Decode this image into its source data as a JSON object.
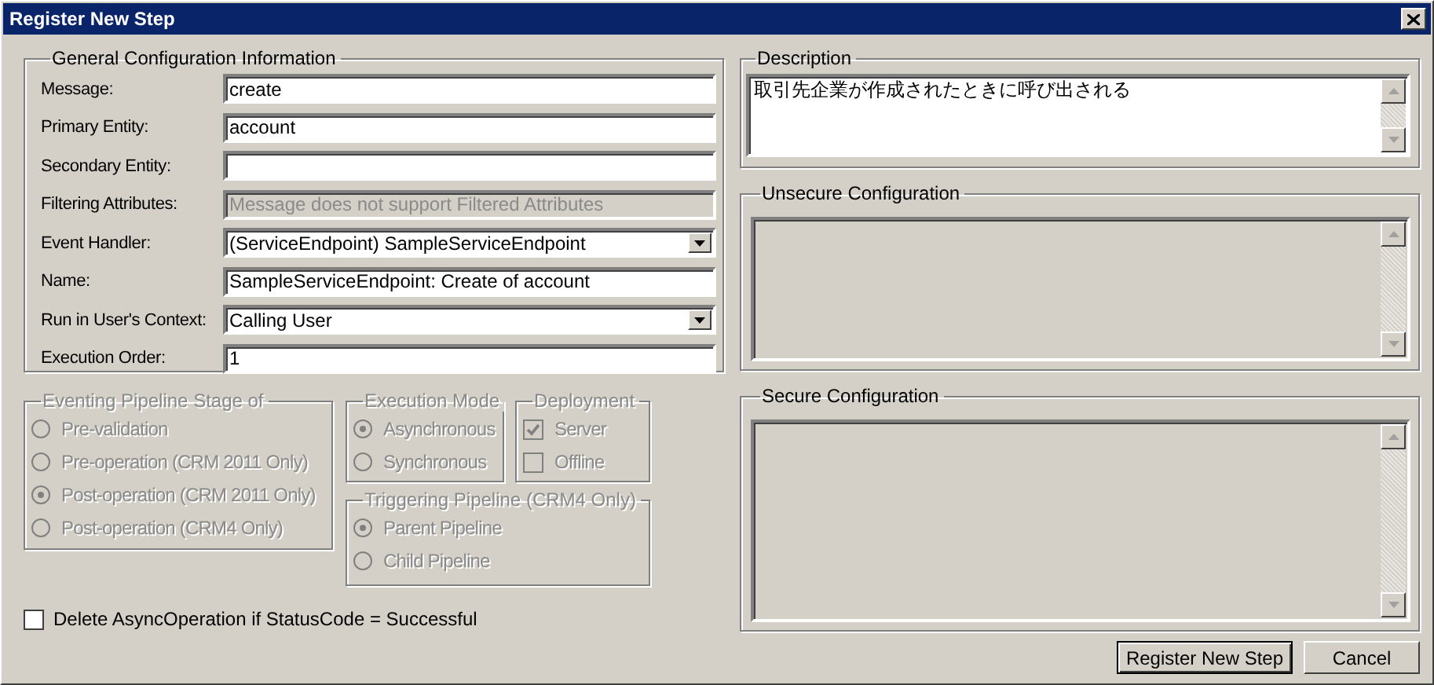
{
  "window": {
    "title": "Register New Step"
  },
  "general": {
    "title": "General Configuration Information",
    "fields": [
      {
        "label": "Message:",
        "kind": "text",
        "value": "create",
        "disabled": false
      },
      {
        "label": "Primary Entity:",
        "kind": "text",
        "value": "account",
        "disabled": false
      },
      {
        "label": "Secondary Entity:",
        "kind": "text",
        "disabled": false
      },
      {
        "label": "Filtering Attributes:",
        "kind": "text",
        "value": "Message does not support Filtered Attributes",
        "disabled": true
      },
      {
        "label": "Event Handler:",
        "kind": "select",
        "value": "(ServiceEndpoint) SampleServiceEndpoint",
        "disabled": false
      },
      {
        "label": "Name:",
        "kind": "text",
        "value": "SampleServiceEndpoint: Create of account",
        "disabled": false
      },
      {
        "label": "Run in User's Context:",
        "kind": "select",
        "value": "Calling User",
        "disabled": false
      },
      {
        "label": "Execution Order:",
        "kind": "text",
        "value": "1",
        "disabled": false
      }
    ]
  },
  "stage": {
    "title": "Eventing Pipeline Stage of",
    "disabled": true,
    "options": [
      {
        "label": "Pre-validation",
        "selected": false
      },
      {
        "label": "Pre-operation (CRM 2011 Only)",
        "selected": false
      },
      {
        "label": "Post-operation (CRM 2011 Only)",
        "selected": true
      },
      {
        "label": "Post-operation (CRM4 Only)",
        "selected": false
      }
    ]
  },
  "execution_mode": {
    "title": "Execution Mode",
    "disabled": true,
    "options": [
      {
        "label": "Asynchronous",
        "selected": true
      },
      {
        "label": "Synchronous",
        "selected": false
      }
    ]
  },
  "deployment": {
    "title": "Deployment",
    "disabled": true,
    "options": [
      {
        "label": "Server",
        "checked": true
      },
      {
        "label": "Offline",
        "checked": false
      }
    ]
  },
  "triggering": {
    "title": "Triggering Pipeline (CRM4 Only)",
    "disabled": true,
    "options": [
      {
        "label": "Parent Pipeline",
        "selected": true
      },
      {
        "label": "Child Pipeline",
        "selected": false
      }
    ]
  },
  "delete_async": {
    "label": "Delete AsyncOperation if StatusCode = Successful",
    "checked": false,
    "disabled": false
  },
  "description": {
    "title": "Description",
    "value": "取引先企業が作成されたときに呼び出される",
    "disabled": false
  },
  "unsecure": {
    "title": "Unsecure Configuration",
    "disabled": true
  },
  "secure": {
    "title": "Secure Configuration",
    "disabled": true
  },
  "buttons": [
    {
      "label": "Register New Step",
      "default": true
    },
    {
      "label": "Cancel",
      "default": false
    }
  ]
}
